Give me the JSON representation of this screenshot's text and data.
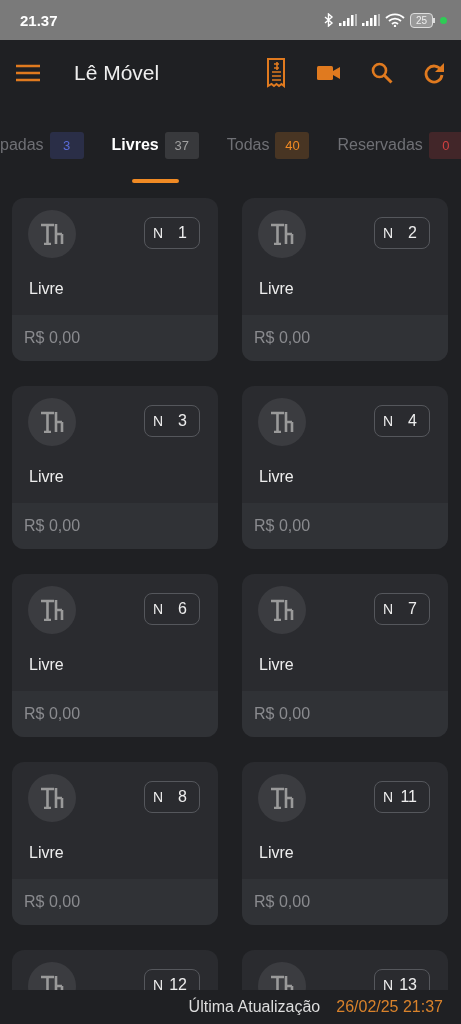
{
  "status_bar": {
    "time": "21.37",
    "battery": "25"
  },
  "app_bar": {
    "title": "Lê Móvel"
  },
  "tabs": [
    {
      "label": "padas",
      "count": "3",
      "color": "#5a6bd8",
      "selected": false
    },
    {
      "label": "Livres",
      "count": "37",
      "color": "#a0a0a0",
      "selected": true
    },
    {
      "label": "Todas",
      "count": "40",
      "color": "#f08a24",
      "selected": false
    },
    {
      "label": "Reservadas",
      "count": "0",
      "color": "#d04040",
      "selected": false
    }
  ],
  "tables": [
    {
      "prefix": "N",
      "number": "1",
      "status": "Livre",
      "total": "R$ 0,00"
    },
    {
      "prefix": "N",
      "number": "2",
      "status": "Livre",
      "total": "R$ 0,00"
    },
    {
      "prefix": "N",
      "number": "3",
      "status": "Livre",
      "total": "R$ 0,00"
    },
    {
      "prefix": "N",
      "number": "4",
      "status": "Livre",
      "total": "R$ 0,00"
    },
    {
      "prefix": "N",
      "number": "6",
      "status": "Livre",
      "total": "R$ 0,00"
    },
    {
      "prefix": "N",
      "number": "7",
      "status": "Livre",
      "total": "R$ 0,00"
    },
    {
      "prefix": "N",
      "number": "8",
      "status": "Livre",
      "total": "R$ 0,00"
    },
    {
      "prefix": "N",
      "number": "11",
      "status": "Livre",
      "total": "R$ 0,00"
    },
    {
      "prefix": "N",
      "number": "12"
    },
    {
      "prefix": "N",
      "number": "13"
    }
  ],
  "footer": {
    "label": "Última Atualização",
    "timestamp": "26/02/25 21:37"
  }
}
